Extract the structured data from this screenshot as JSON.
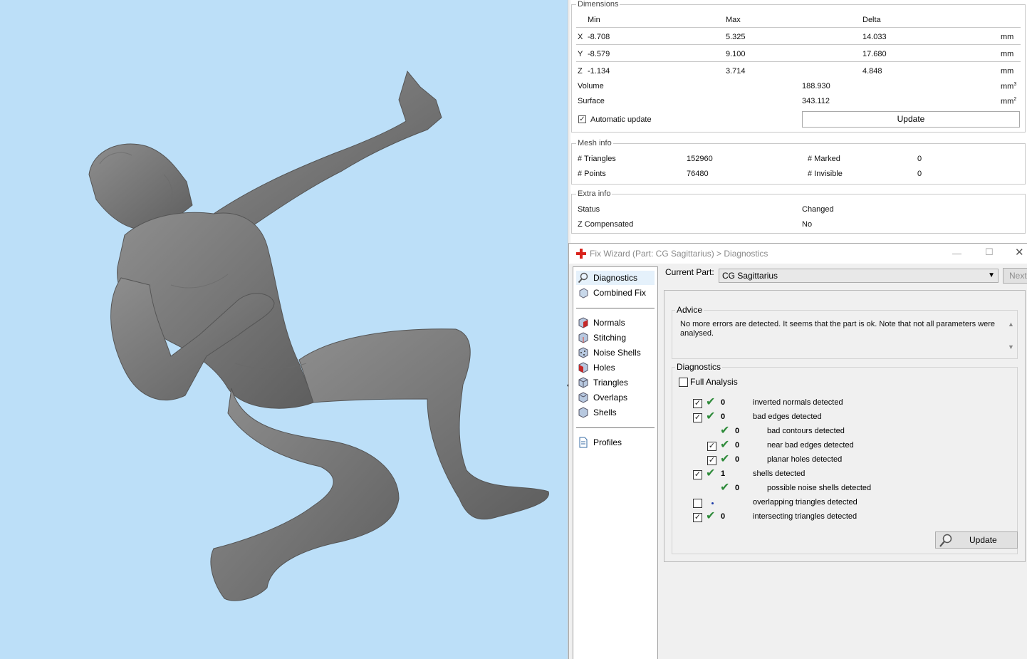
{
  "dimensions": {
    "legend": "Dimensions",
    "headers": {
      "min": "Min",
      "max": "Max",
      "delta": "Delta"
    },
    "rows": [
      {
        "axis": "X",
        "min": "-8.708",
        "max": "5.325",
        "delta": "14.033",
        "unit": "mm"
      },
      {
        "axis": "Y",
        "min": "-8.579",
        "max": "9.100",
        "delta": "17.680",
        "unit": "mm"
      },
      {
        "axis": "Z",
        "min": "-1.134",
        "max": "3.714",
        "delta": "4.848",
        "unit": "mm"
      }
    ],
    "volume": {
      "label": "Volume",
      "value": "188.930",
      "unit": "mm",
      "exp": "3"
    },
    "surface": {
      "label": "Surface",
      "value": "343.112",
      "unit": "mm",
      "exp": "2"
    },
    "auto_update": {
      "label": "Automatic update",
      "checked": true
    },
    "update_label": "Update"
  },
  "mesh_info": {
    "legend": "Mesh info",
    "triangles_label": "# Triangles",
    "triangles": "152960",
    "points_label": "# Points",
    "points": "76480",
    "marked_label": "# Marked",
    "marked": "0",
    "invisible_label": "# Invisible",
    "invisible": "0"
  },
  "extra_info": {
    "legend": "Extra info",
    "status_label": "Status",
    "status": "Changed",
    "zcomp_label": "Z Compensated",
    "zcomp": "No"
  },
  "wizard": {
    "title": "Fix Wizard (Part: CG Sagittarius) > Diagnostics",
    "nav": [
      {
        "label": "Diagnostics",
        "icon": "magnifier-icon",
        "selected": true
      },
      {
        "label": "Combined Fix",
        "icon": "combined-fix-icon"
      },
      {
        "label": "Normals",
        "icon": "normals-cube-icon"
      },
      {
        "label": "Stitching",
        "icon": "stitching-cube-icon"
      },
      {
        "label": "Noise Shells",
        "icon": "noise-shells-icon"
      },
      {
        "label": "Holes",
        "icon": "holes-cube-icon"
      },
      {
        "label": "Triangles",
        "icon": "triangles-cube-icon"
      },
      {
        "label": "Overlaps",
        "icon": "overlaps-cube-icon"
      },
      {
        "label": "Shells",
        "icon": "shells-cube-icon"
      },
      {
        "label": "Profiles",
        "icon": "document-icon"
      }
    ],
    "current_part_label": "Current Part:",
    "current_part": "CG Sagittarius",
    "next_label": "Next",
    "advice": {
      "legend": "Advice",
      "text": "No more errors are detected. It seems that the part is ok. Note that not all parameters were analysed."
    },
    "diagnostics": {
      "legend": "Diagnostics",
      "full_analysis_label": "Full Analysis",
      "full_analysis_checked": false,
      "rows": [
        {
          "checkbox": true,
          "checked": true,
          "status": "ok",
          "value": "0",
          "label": "inverted normals detected",
          "indent": 0
        },
        {
          "checkbox": true,
          "checked": true,
          "status": "ok",
          "value": "0",
          "label": "bad edges detected",
          "indent": 0
        },
        {
          "checkbox": false,
          "checked": false,
          "status": "ok",
          "value": "0",
          "label": "bad contours detected",
          "indent": 1
        },
        {
          "checkbox": true,
          "checked": true,
          "status": "ok",
          "value": "0",
          "label": "near bad edges detected",
          "indent": 1
        },
        {
          "checkbox": true,
          "checked": true,
          "status": "ok",
          "value": "0",
          "label": "planar holes detected",
          "indent": 1
        },
        {
          "checkbox": true,
          "checked": true,
          "status": "ok",
          "value": "1",
          "label": "shells detected",
          "indent": 0
        },
        {
          "checkbox": false,
          "checked": false,
          "status": "ok",
          "value": "0",
          "label": "possible noise shells detected",
          "indent": 1
        },
        {
          "checkbox": true,
          "checked": false,
          "status": "dot",
          "value": "",
          "label": "overlapping triangles detected",
          "indent": 0
        },
        {
          "checkbox": true,
          "checked": true,
          "status": "ok",
          "value": "0",
          "label": "intersecting triangles detected",
          "indent": 0
        }
      ],
      "update_label": "Update"
    }
  },
  "colors": {
    "viewport_bg": "#bcdff8",
    "model": "#7a7a7a",
    "ok_tick": "#2e8b3a"
  }
}
